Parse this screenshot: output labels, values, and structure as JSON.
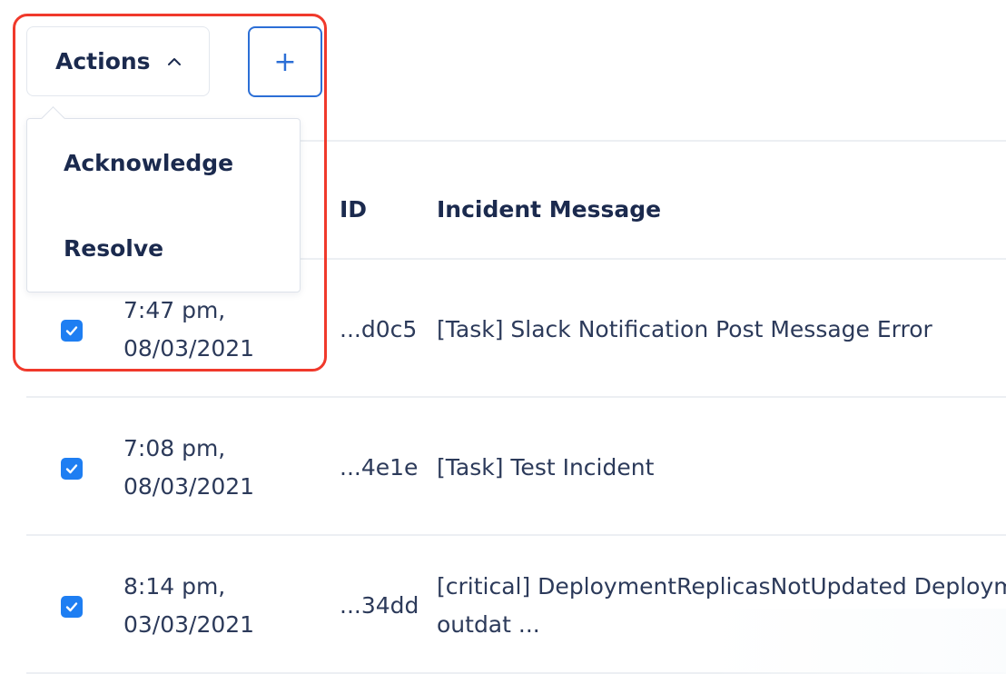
{
  "toolbar": {
    "actions_label": "Actions",
    "add_label": "+"
  },
  "actions_menu": {
    "items": [
      {
        "label": "Acknowledge"
      },
      {
        "label": "Resolve"
      }
    ]
  },
  "table": {
    "columns": [
      "ID",
      "Incident Message"
    ],
    "rows": [
      {
        "checked": true,
        "time": "7:47 pm,",
        "date": "08/03/2021",
        "id": "...d0c5",
        "message": "[Task] Slack Notification Post Message Error",
        "message_cont": ""
      },
      {
        "checked": true,
        "time": "7:08 pm,",
        "date": "08/03/2021",
        "id": "...4e1e",
        "message": "[Task] Test Incident",
        "message_cont": ""
      },
      {
        "checked": true,
        "time": "8:14 pm,",
        "date": "03/03/2021",
        "id": "...34dd",
        "message": "[critical] DeploymentReplicasNotUpdated Deploym",
        "message_cont": "outdat ..."
      }
    ]
  },
  "colors": {
    "accent": "#2c6fd6",
    "checkbox": "#1e7ef2",
    "highlight": "#f0392b",
    "text": "#1b2a4e"
  }
}
